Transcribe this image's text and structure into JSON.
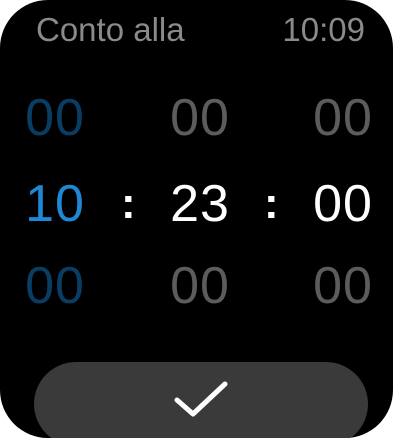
{
  "header": {
    "title": "Conto alla",
    "time": "10:09"
  },
  "picker": {
    "hours": {
      "prev": "00",
      "current": "10",
      "next": "00"
    },
    "minutes": {
      "prev": "00",
      "current": "23",
      "next": "00"
    },
    "seconds": {
      "prev": "00",
      "current": "00",
      "next": "00"
    },
    "separator": ":"
  },
  "colors": {
    "background": "#000000",
    "accent": "#1e88d4",
    "muted_text": "#8a8a8a",
    "button": "#3a3a3a"
  },
  "confirm_button": {
    "icon": "checkmark-icon"
  }
}
